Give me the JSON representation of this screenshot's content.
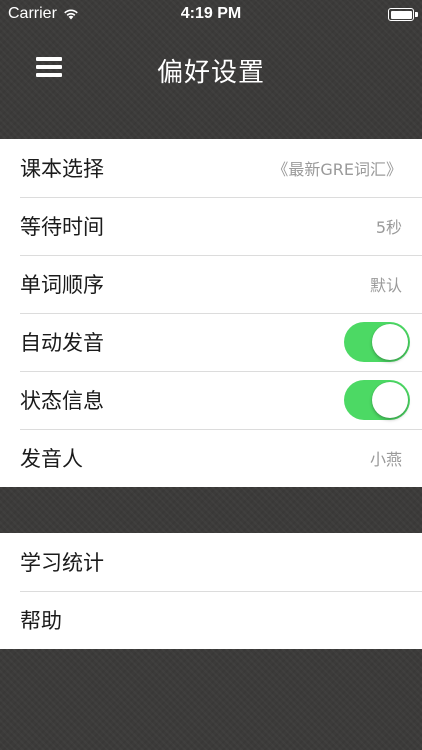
{
  "status_bar": {
    "carrier": "Carrier",
    "time": "4:19 PM"
  },
  "nav": {
    "title": "偏好设置",
    "menu_icon": "hamburger-menu-icon"
  },
  "settings": {
    "textbook": {
      "label": "课本选择",
      "value": "《最新GRE词汇》"
    },
    "wait_time": {
      "label": "等待时间",
      "value": "5秒"
    },
    "word_order": {
      "label": "单词顺序",
      "value": "默认"
    },
    "auto_pronounce": {
      "label": "自动发音",
      "on": true
    },
    "status_info": {
      "label": "状态信息",
      "on": true
    },
    "speaker": {
      "label": "发音人",
      "value": "小燕"
    }
  },
  "extras": {
    "statistics": {
      "label": "学习统计"
    },
    "help": {
      "label": "帮助"
    }
  },
  "colors": {
    "toggle_on": "#4cd964",
    "background": "#3b3a39"
  }
}
